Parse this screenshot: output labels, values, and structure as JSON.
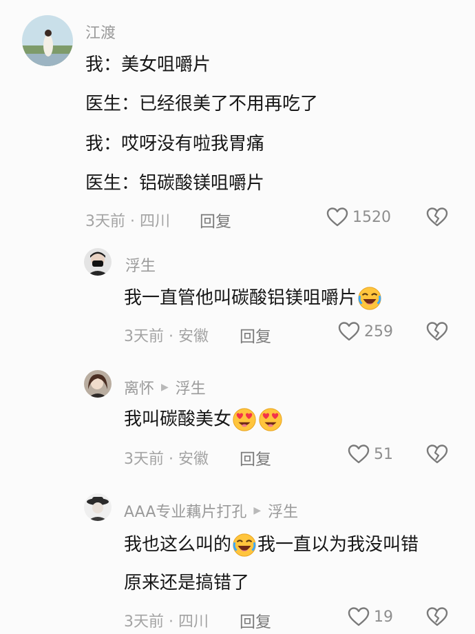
{
  "comments": [
    {
      "user": "江渡",
      "lines": [
        "我：美女咀嚼片",
        "医生：已经很美了不用再吃了",
        "我：哎呀没有啦我胃痛",
        "医生：铝碳酸镁咀嚼片"
      ],
      "meta": "3天前 · 四川",
      "reply": "回复",
      "likes": "1520"
    },
    {
      "user": "浮生",
      "text": "我一直管他叫碳酸铝镁咀嚼片",
      "meta": "3天前 · 安徽",
      "reply": "回复",
      "likes": "259"
    },
    {
      "user": "离怀",
      "reply_to": "浮生",
      "text": "我叫碳酸美女",
      "meta": "3天前 · 安徽",
      "reply": "回复",
      "likes": "51"
    },
    {
      "user": "AAA专业藕片打孔",
      "reply_to": "浮生",
      "text_a": "我也这么叫的",
      "text_b": "我一直以为我没叫错",
      "text_line2": "原来还是搞错了",
      "meta": "3天前 · 四川",
      "reply": "回复",
      "likes": "19"
    }
  ]
}
